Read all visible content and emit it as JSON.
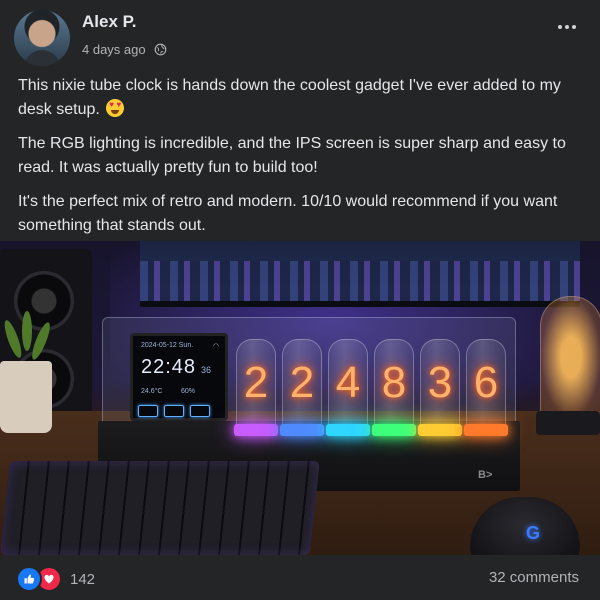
{
  "post": {
    "author": "Alex P.",
    "time": "4 days ago",
    "paragraphs": [
      "This nixie tube clock is hands down the coolest gadget I've ever added to my desk setup.",
      "The RGB lighting is incredible, and the IPS screen is super sharp and easy to read. It was actually pretty fun to build too!",
      "It's the perfect mix of retro and modern. 10/10 would recommend if you want something that stands out."
    ]
  },
  "photo": {
    "lcd": {
      "date": "2024-05-12 Sun.",
      "time": "22:48",
      "seconds": "36",
      "temperature": "24.6°C",
      "humidity": "60%"
    },
    "nixie_digits": [
      "2",
      "2",
      "4",
      "8",
      "3",
      "6"
    ],
    "nixie_glow_colors": [
      "#c85cff",
      "#4f8bff",
      "#2fd6ff",
      "#3dff7a",
      "#ffcc33",
      "#ff7a2a"
    ],
    "logo": "B>"
  },
  "footer": {
    "reaction_count": "142",
    "comments": "32 comments"
  },
  "colors": {
    "card_bg": "#242526",
    "like_blue": "#1877f2",
    "love_red": "#f02849"
  }
}
